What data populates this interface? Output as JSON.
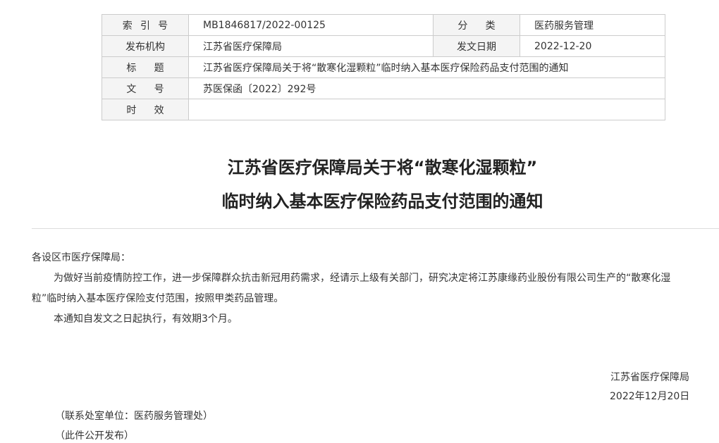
{
  "meta_table": {
    "index_label": "索引号",
    "index_value": "MB1846817/2022-00125",
    "category_label": "分类",
    "category_value": "医药服务管理",
    "issuer_label": "发布机构",
    "issuer_value": "江苏省医疗保障局",
    "date_label": "发文日期",
    "date_value": "2022-12-20",
    "title_label": "标题",
    "title_value": "江苏省医疗保障局关于将“散寒化湿颗粒”临时纳入基本医疗保险药品支付范围的通知",
    "docno_label": "文号",
    "docno_value": "苏医保函〔2022〕292号",
    "validity_label": "时效",
    "validity_value": ""
  },
  "document": {
    "title_line1": "江苏省医疗保障局关于将“散寒化湿颗粒”",
    "title_line2": "临时纳入基本医疗保险药品支付范围的通知",
    "salutation": "各设区市医疗保障局：",
    "para1_line1": "为做好当前疫情防控工作，进一步保障群众抗击新冠用药需求，经请示上级有关部门，研究决定将江苏康缘药业股份有限公司生产的“散寒化湿",
    "para1_line2": "粒”临时纳入基本医疗保险支付范围，按照甲类药品管理。",
    "para2": "本通知自发文之日起执行，有效期3个月。",
    "signature_org": "江苏省医疗保障局",
    "signature_date": "2022年12月20日",
    "note_contact": "（联系处室单位：医药服务管理处）",
    "note_public": "（此件公开发布）"
  }
}
